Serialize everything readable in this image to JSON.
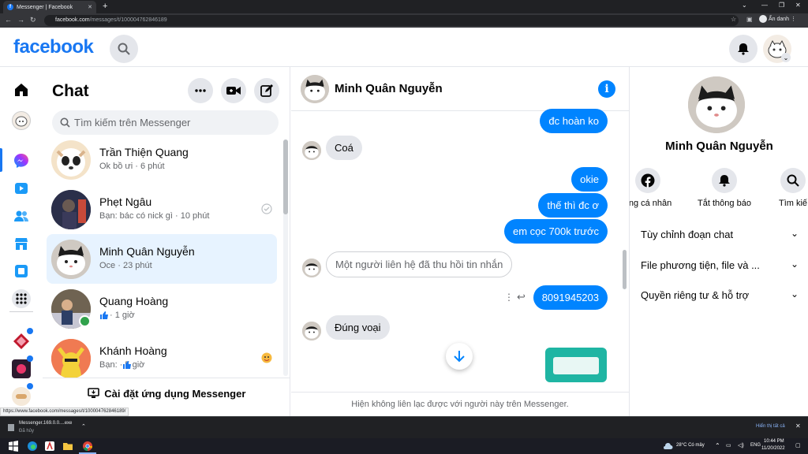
{
  "browser": {
    "tab_title": "Messenger | Facebook",
    "new_tab": "+",
    "url_domain": "facebook.com",
    "url_path": "/messages/t/100004762846189",
    "profile_label": "Ẩn danh",
    "status_url": "https://www.facebook.com/messages/t/100004762846189/"
  },
  "header": {
    "logo": "facebook"
  },
  "chat_list": {
    "title": "Chat",
    "search_placeholder": "Tìm kiếm trên Messenger",
    "conversations": [
      {
        "name": "Trần Thiện Quang",
        "preview": "Ok bồ ưi · 6 phút",
        "active": false
      },
      {
        "name": "Phẹt Ngâu",
        "preview": "Bạn: bác có nick gì · 10 phút",
        "active": false
      },
      {
        "name": "Minh Quân Nguyễn",
        "preview": "Oce · 23 phút",
        "active": true
      },
      {
        "name": "Quang Hoàng",
        "preview": " · 1 giờ",
        "active": false
      },
      {
        "name": "Khánh Hoàng",
        "preview": "Bạn:  · 5 giờ",
        "active": false
      }
    ],
    "install_label": "Cài đặt ứng dụng Messenger"
  },
  "conversation": {
    "name": "Minh Quân Nguyễn",
    "messages": [
      {
        "text": "đc hoàn ko",
        "dir": "out"
      },
      {
        "text": "Coá",
        "dir": "in"
      },
      {
        "text": "okie",
        "dir": "out"
      },
      {
        "text": "thế thì đc ơ",
        "dir": "out"
      },
      {
        "text": "em cọc 700k trước",
        "dir": "out"
      },
      {
        "text": "Một người liên hệ đã thu hồi tin nhắn",
        "dir": "recalled"
      },
      {
        "text": "8091945203",
        "dir": "out"
      },
      {
        "text": "Đúng voại",
        "dir": "in"
      }
    ],
    "footnote": "Hiện không liên lạc được với người này trên Messenger."
  },
  "info_panel": {
    "name": "Minh Quân Nguyễn",
    "actions": [
      "ang cá nhân",
      "Tắt thông báo",
      "Tìm kiế"
    ],
    "sections": [
      "Tùy chỉnh đoạn chat",
      "File phương tiện, file và ...",
      "Quyền riêng tư & hỗ trợ"
    ]
  },
  "download": {
    "file": "Messenger.169.0.0....exe",
    "status": "Đã hủy",
    "show_all": "Hiển thị tất cả"
  },
  "taskbar": {
    "weather": "28°C  Có mây",
    "lang": "ENG",
    "time": "10:44 PM",
    "date": "11/20/2022"
  },
  "colors": {
    "brand": "#1877f2",
    "outgoing": "#0084ff",
    "active_row": "#e7f3ff"
  }
}
